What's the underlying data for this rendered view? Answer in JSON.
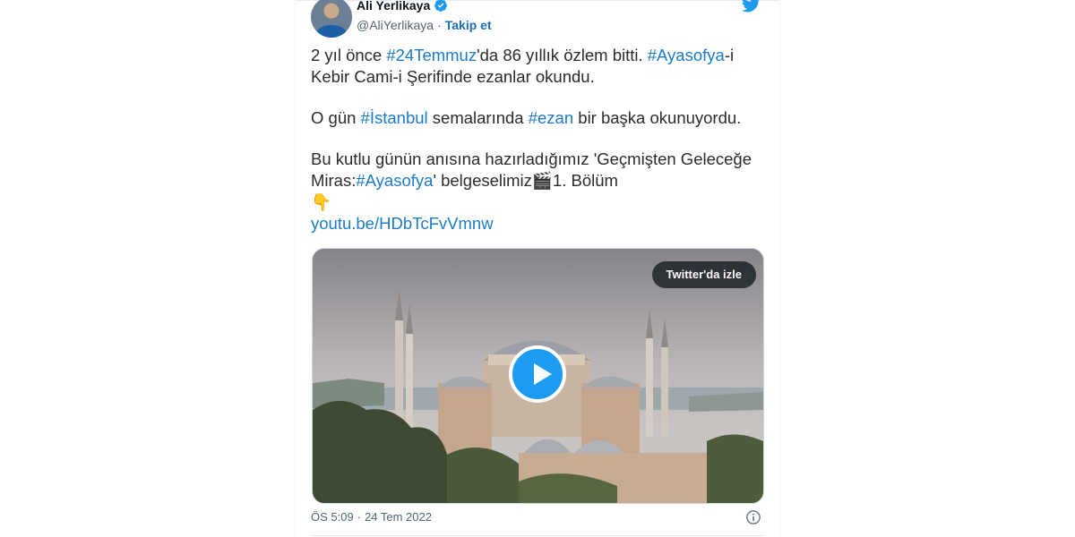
{
  "author": {
    "name": "Ali Yerlikaya",
    "handle": "@AliYerlikaya",
    "separator": "·",
    "follow_label": "Takip et"
  },
  "tweet": {
    "p1": {
      "t1": "2 yıl önce ",
      "h1": "#24Temmuz",
      "t2": "'da 86 yıllık özlem bitti. ",
      "h2": "#Ayasofya",
      "t3": "-i Kebir Cami-i Şerifinde ezanlar okundu."
    },
    "p2": {
      "t1": "O gün ",
      "h1": "#İstanbul",
      "t2": " semalarında ",
      "h2": "#ezan",
      "t3": " bir başka okunuyordu."
    },
    "p3": {
      "t1": "Bu kutlu günün anısına hazırladığımız 'Geçmişten Geleceğe Miras:",
      "h1": "#Ayasofya",
      "t2": "' belgeselimiz🎬1. Bölüm"
    },
    "p4": {
      "emoji": "👇"
    },
    "link": "youtu.be/HDbTcFvVmnw"
  },
  "media": {
    "watch_label": "Twitter'da izle"
  },
  "footer": {
    "time": "ÖS 5:09",
    "separator": "·",
    "date": "24 Tem 2022"
  },
  "icons": {
    "bird": "twitter-bird-icon",
    "verified": "verified-badge-icon",
    "play": "play-icon",
    "info": "info-icon"
  },
  "colors": {
    "accent": "#1d9bf0",
    "link": "#1d7bc9"
  }
}
